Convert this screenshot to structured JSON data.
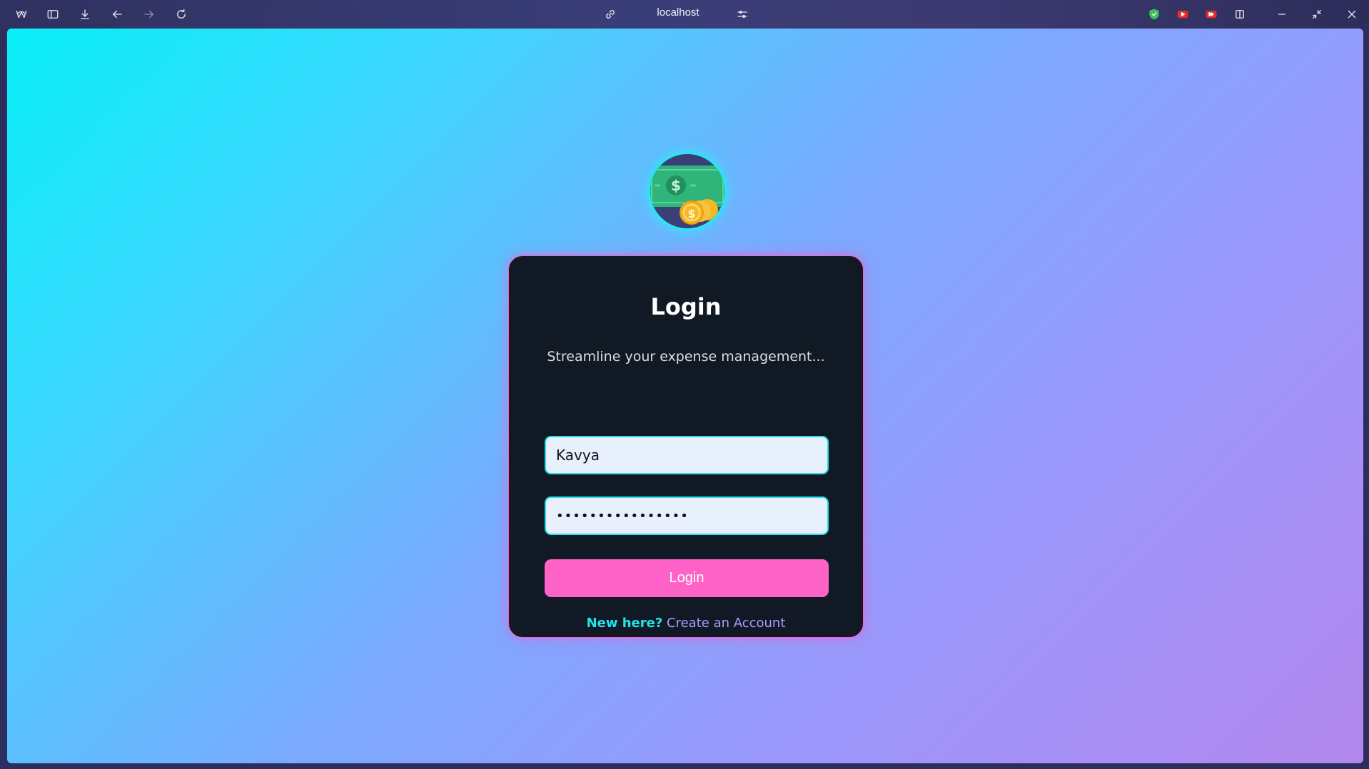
{
  "browser": {
    "url": "localhost",
    "icons": [
      "browser-logo-icon",
      "sidebar-toggle-icon",
      "download-icon",
      "back-arrow-icon",
      "forward-arrow-icon",
      "reload-icon",
      "link-icon",
      "site-settings-icon",
      "shield-extension-icon",
      "youtube-extension-icon",
      "video-speed-extension-icon",
      "split-view-icon",
      "minimize-icon",
      "restore-icon",
      "close-icon"
    ]
  },
  "logo": {
    "icon": "money-coins-icon",
    "colors": {
      "bill": "#2fb57a",
      "coin": "#f5b722",
      "ring": "#24e7ef"
    }
  },
  "login": {
    "title": "Login",
    "subtitle": "Streamline your expense management...",
    "username_value": "Kavya",
    "password_value": "••••••••••••••••",
    "button_label": "Login",
    "signup_prompt": "New here?",
    "signup_link": "Create an Account"
  },
  "colors": {
    "card_bg": "#111a24",
    "accent_pink": "#ff63c8",
    "accent_cyan": "#27dfe6",
    "link_purple": "#a99bff"
  }
}
